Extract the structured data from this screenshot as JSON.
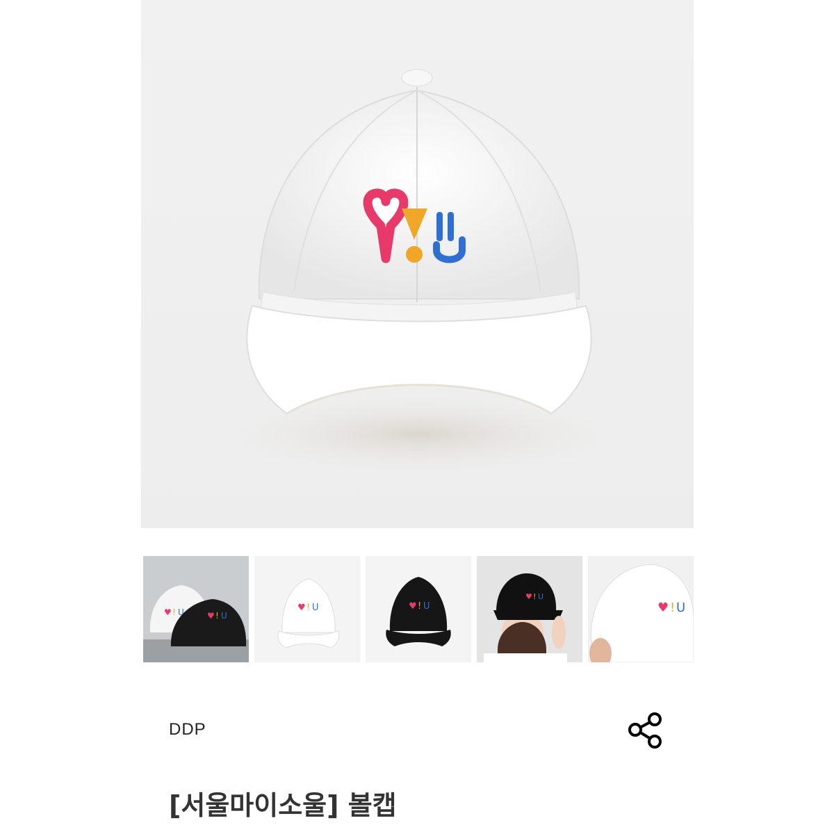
{
  "product": {
    "brand": "DDP",
    "title": "[서울마이소울] 볼캡",
    "main_image": "white-ballcap-front",
    "thumbnails": [
      "two-caps-white-black",
      "white-cap-front",
      "black-cap-front",
      "woman-wearing-black-cap",
      "man-wearing-white-cap"
    ]
  },
  "actions": {
    "share_icon": "share-icon"
  },
  "colors": {
    "heart": "#e83a6a",
    "exclamation": "#f0a626",
    "smile": "#2f6fd2",
    "text": "#222222"
  }
}
